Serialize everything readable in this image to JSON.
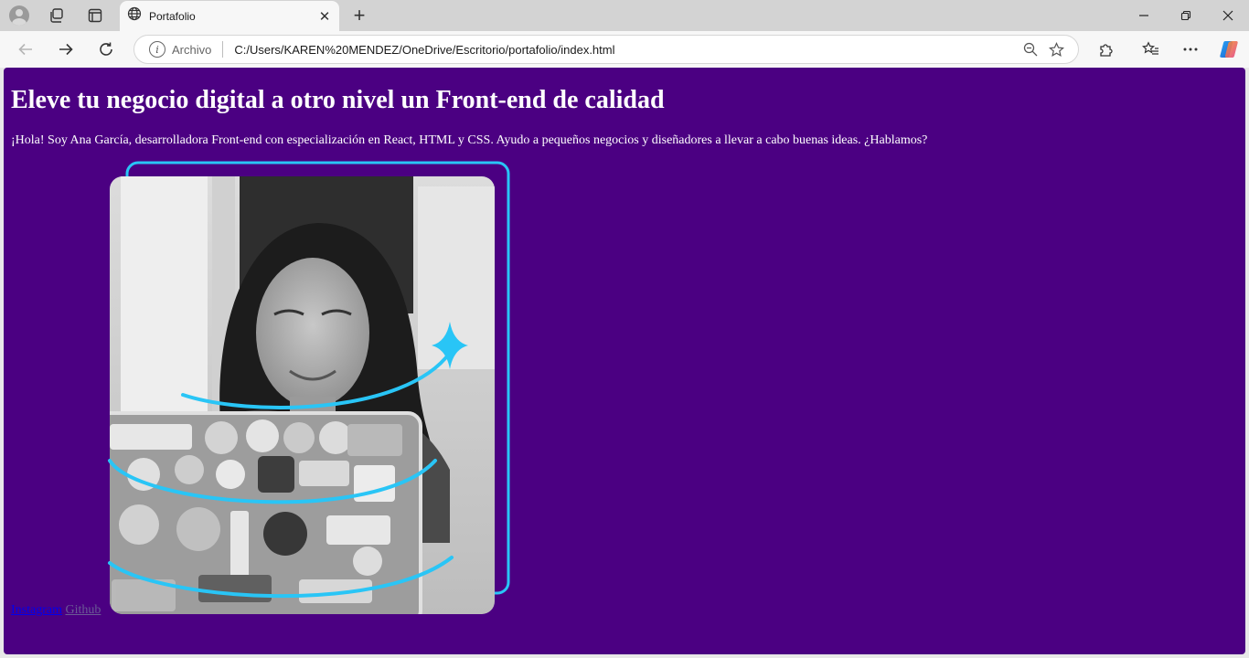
{
  "browser": {
    "tab": {
      "title": "Portafolio"
    },
    "address": {
      "label": "Archivo",
      "url": "C:/Users/KAREN%20MENDEZ/OneDrive/Escritorio/portafolio/index.html"
    },
    "icons": {
      "tab_actions": "tab-actions-icon",
      "vertical_tabs": "vertical-tabs-icon",
      "site": "globe-icon",
      "zoom": "zoom-out-icon",
      "favorite": "star-icon",
      "extensions": "puzzle-icon",
      "favorites": "favorites-icon",
      "more": "more-icon",
      "copilot": "copilot-icon"
    }
  },
  "page": {
    "title": "Eleve tu negocio digital a otro nivel un Front-end de calidad",
    "intro": "¡Hola! Soy Ana García, desarrolladora Front-end con especialización en React, HTML y CSS. Ayudo a pequeños negocios y diseñadores a llevar a cabo buenas ideas. ¿Hablamos?",
    "links": {
      "instagram": "Instagram",
      "github": "Github"
    },
    "colors": {
      "background": "#4b0082",
      "accent": "#29c5f6",
      "text": "#ffffff"
    }
  }
}
